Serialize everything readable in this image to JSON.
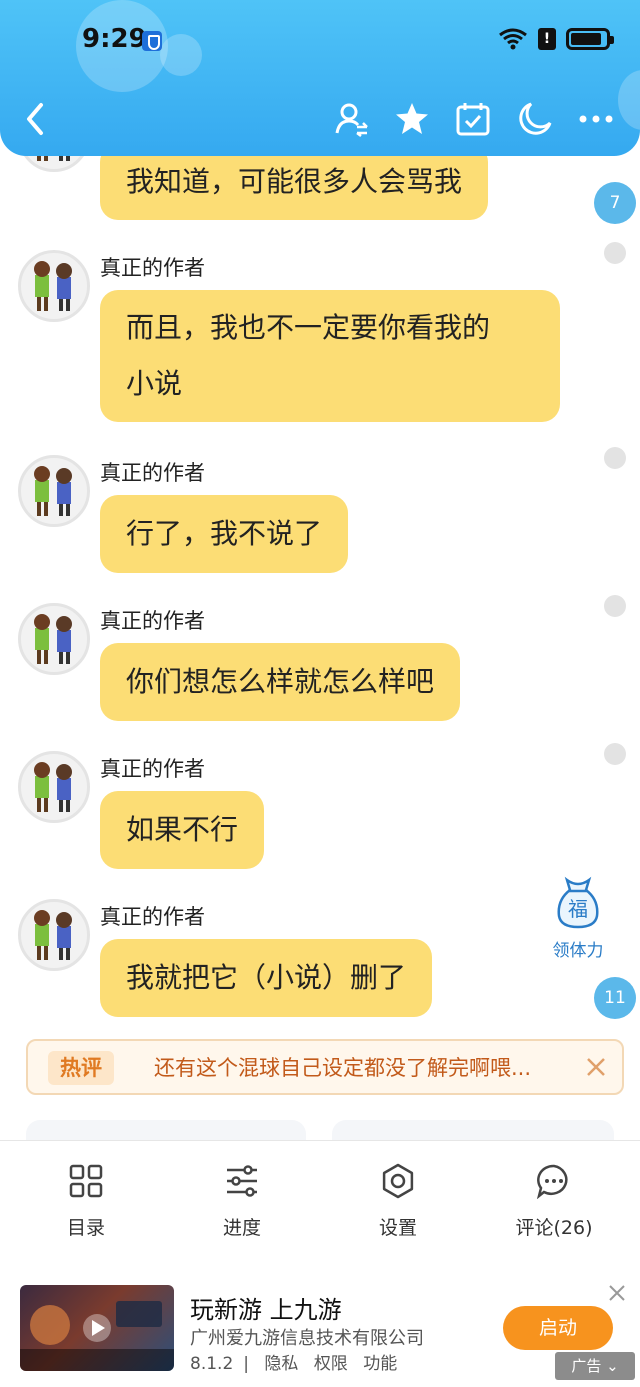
{
  "status_bar": {
    "time": "9:29",
    "battery_icon": "battery-icon",
    "wifi_icon": "wifi-icon",
    "alert": "!"
  },
  "toolbar": {
    "icons": [
      "back-icon",
      "switch-user-icon",
      "star-icon",
      "calendar-check-icon",
      "moon-icon",
      "more-icon"
    ]
  },
  "messages": [
    {
      "sender": "",
      "lines": [
        "我知道，可能很多人会骂我"
      ],
      "badge": "7"
    },
    {
      "sender": "真正的作者",
      "lines": [
        "而且，我也不一定要你看我的",
        "小说"
      ]
    },
    {
      "sender": "真正的作者",
      "lines": [
        "行了，我不说了"
      ]
    },
    {
      "sender": "真正的作者",
      "lines": [
        "你们想怎么样就怎么样吧"
      ]
    },
    {
      "sender": "真正的作者",
      "lines": [
        "如果不行"
      ]
    },
    {
      "sender": "真正的作者",
      "lines": [
        "我就把它（小说）删了"
      ],
      "badge": "11"
    }
  ],
  "float_button": {
    "glyph": "福",
    "label": "领体力"
  },
  "hot_comment": {
    "tag": "热评",
    "text": "还有这个混球自己设定都没了解完啊喂..."
  },
  "bottom_nav": [
    {
      "label": "目录",
      "icon": "grid-icon"
    },
    {
      "label": "进度",
      "icon": "sliders-icon"
    },
    {
      "label": "设置",
      "icon": "gear-icon"
    },
    {
      "label": "评论(26)",
      "icon": "comment-icon"
    }
  ],
  "ad": {
    "title": "玩新游 上九游",
    "company": "广州爱九游信息技术有限公司",
    "version": "8.1.2",
    "links": [
      "隐私",
      "权限",
      "功能"
    ],
    "button": "启动",
    "label": "广告"
  },
  "colors": {
    "header": "#35a9f0",
    "bubble": "#fcdd75",
    "badge": "#5bb8ea",
    "button": "#f7931e"
  }
}
